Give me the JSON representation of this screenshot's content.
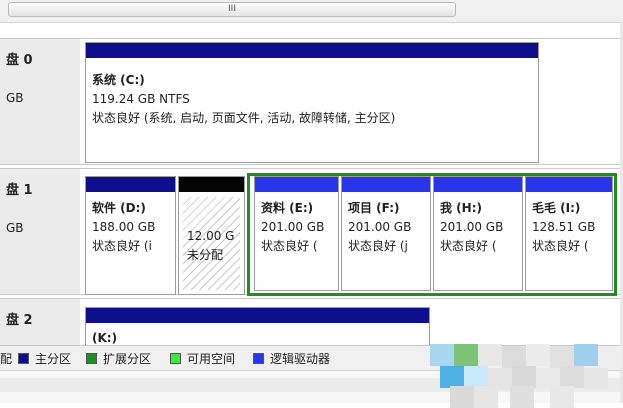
{
  "scrollbar": {
    "grip": "III"
  },
  "disks": [
    {
      "label": "盘 0",
      "size": "GB",
      "volumes": [
        {
          "title": "系统  (C:)",
          "size": "119.24 GB NTFS",
          "status": "状态良好 (系统, 启动, 页面文件, 活动, 故障转储, 主分区)"
        }
      ]
    },
    {
      "label": "盘 1",
      "size": "GB",
      "volumes": [
        {
          "title": "软件  (D:)",
          "size": "188.00 GB",
          "status": "状态良好 (i"
        },
        {
          "title": "",
          "size": "12.00 G",
          "status": "未分配"
        },
        {
          "title": "资料  (E:)",
          "size": "201.00 GB",
          "status": "状态良好 ("
        },
        {
          "title": "项目  (F:)",
          "size": "201.00 GB",
          "status": "状态良好 (j"
        },
        {
          "title": "我  (H:)",
          "size": "201.00 GB",
          "status": "状态良好 ("
        },
        {
          "title": "毛毛  (I:)",
          "size": "128.51 GB",
          "status": "状态良好 ("
        }
      ]
    },
    {
      "label": "盘 2",
      "size": "",
      "volumes": [
        {
          "title": "(K:)",
          "size": "",
          "status": ""
        }
      ]
    }
  ],
  "legend": [
    {
      "label": "配",
      "color": ""
    },
    {
      "label": "主分区",
      "color": "#0d0f8c"
    },
    {
      "label": "扩展分区",
      "color": "#1e8e1e"
    },
    {
      "label": "可用空间",
      "color": "#3ee63e"
    },
    {
      "label": "逻辑驱动器",
      "color": "#2636e8"
    }
  ],
  "colors": {
    "primary": "#0d0f8c",
    "logical": "#2636e8",
    "unallocated": "#050505",
    "extended": "#1e8e1e",
    "free": "#3ee63e"
  }
}
